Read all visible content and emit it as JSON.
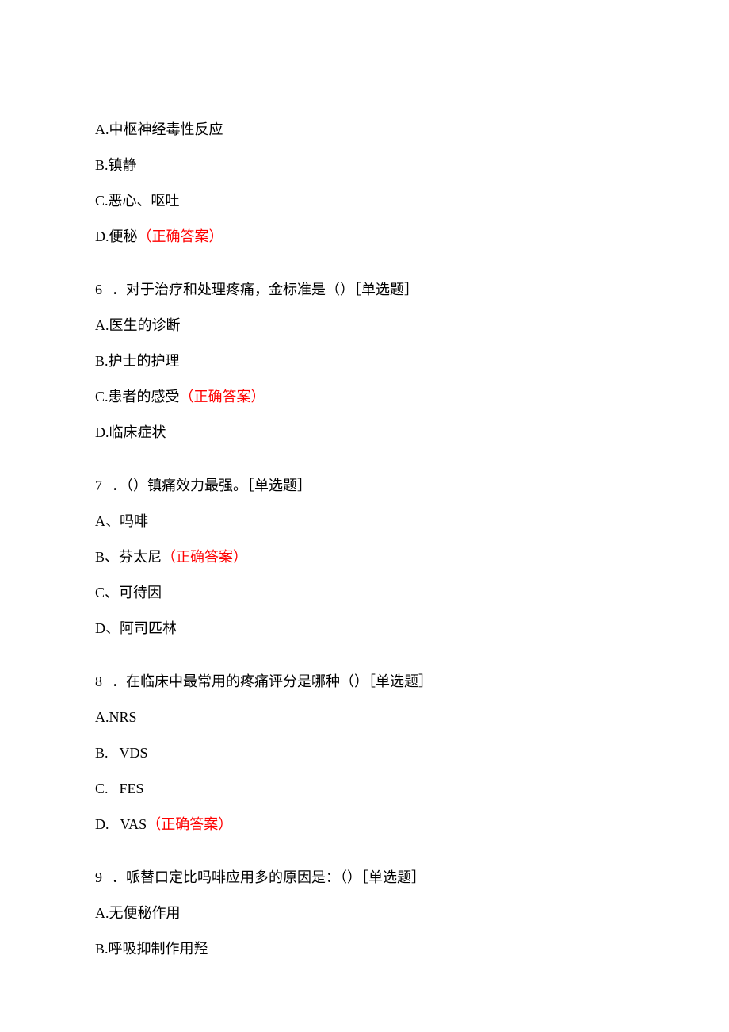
{
  "correct_label": "（正确答案）",
  "q5": {
    "optA": "A.中枢神经毒性反应",
    "optB": "B.镇静",
    "optC": "C.恶心、呕吐",
    "optD_prefix": "D.便秘"
  },
  "q6": {
    "num": "6",
    "text": "．对于治疗和处理疼痛，金标准是（）［单选题］",
    "optA": "A.医生的诊断",
    "optB": "B.护士的护理",
    "optC_prefix": "C.患者的感受",
    "optD": "D.临床症状"
  },
  "q7": {
    "num": "7",
    "text": "．（）镇痛效力最强。［单选题］",
    "optA": "A、吗啡",
    "optB_prefix": "B、芬太尼",
    "optC": "C、可待因",
    "optD": "D、阿司匹林"
  },
  "q8": {
    "num": "8",
    "text": "．在临床中最常用的疼痛评分是哪种（）［单选题］",
    "optA": "A.NRS",
    "optB_label": "B.",
    "optB_val": "VDS",
    "optC_label": "C.",
    "optC_val": "FES",
    "optD_label": "D.",
    "optD_val": "VAS"
  },
  "q9": {
    "num": "9",
    "text": "．哌替口定比吗啡应用多的原因是：（）［单选题］",
    "optA": "A.无便秘作用",
    "optB": "B.呼吸抑制作用羟"
  }
}
